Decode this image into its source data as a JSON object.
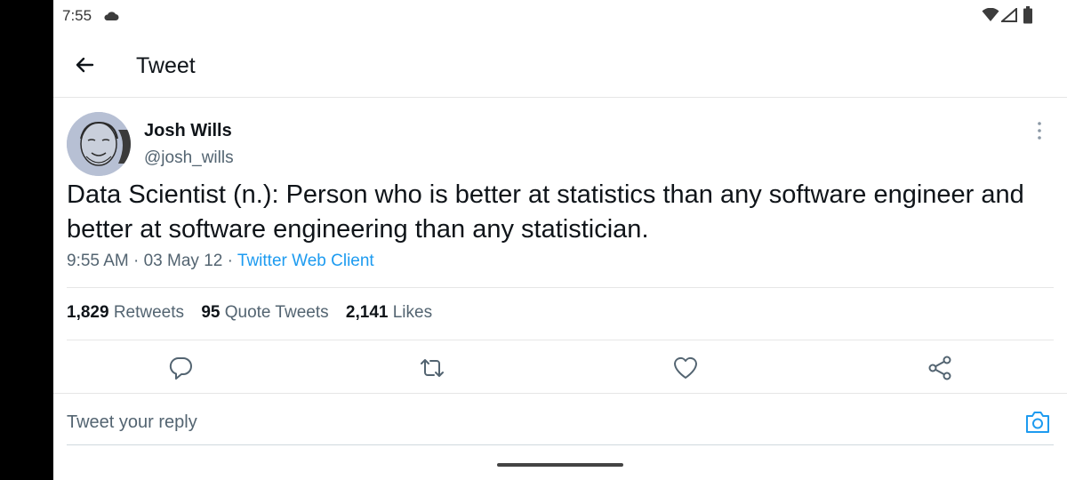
{
  "status_bar": {
    "time": "7:55",
    "icons": [
      "cloud-icon",
      "wifi-icon",
      "signal-icon",
      "battery-icon"
    ]
  },
  "header": {
    "back_icon": "back-arrow-icon",
    "title": "Tweet"
  },
  "tweet": {
    "author": {
      "name": "Josh Wills",
      "handle": "@josh_wills"
    },
    "text": "Data Scientist (n.): Person who is better at statistics than any software engineer and better at software engineering than any statistician.",
    "time": "9:55 AM",
    "date": "03 May 12",
    "source": "Twitter Web Client",
    "separator": "·"
  },
  "stats": {
    "retweets_count": "1,829",
    "retweets_label": "Retweets",
    "quotes_count": "95",
    "quotes_label": "Quote Tweets",
    "likes_count": "2,141",
    "likes_label": "Likes"
  },
  "actions": [
    "reply-icon",
    "retweet-icon",
    "like-icon",
    "share-icon"
  ],
  "reply": {
    "placeholder": "Tweet your reply"
  },
  "colors": {
    "accent": "#1d9bf0",
    "text_primary": "#0f1419",
    "text_secondary": "#536471",
    "divider": "#e6e6e6"
  }
}
